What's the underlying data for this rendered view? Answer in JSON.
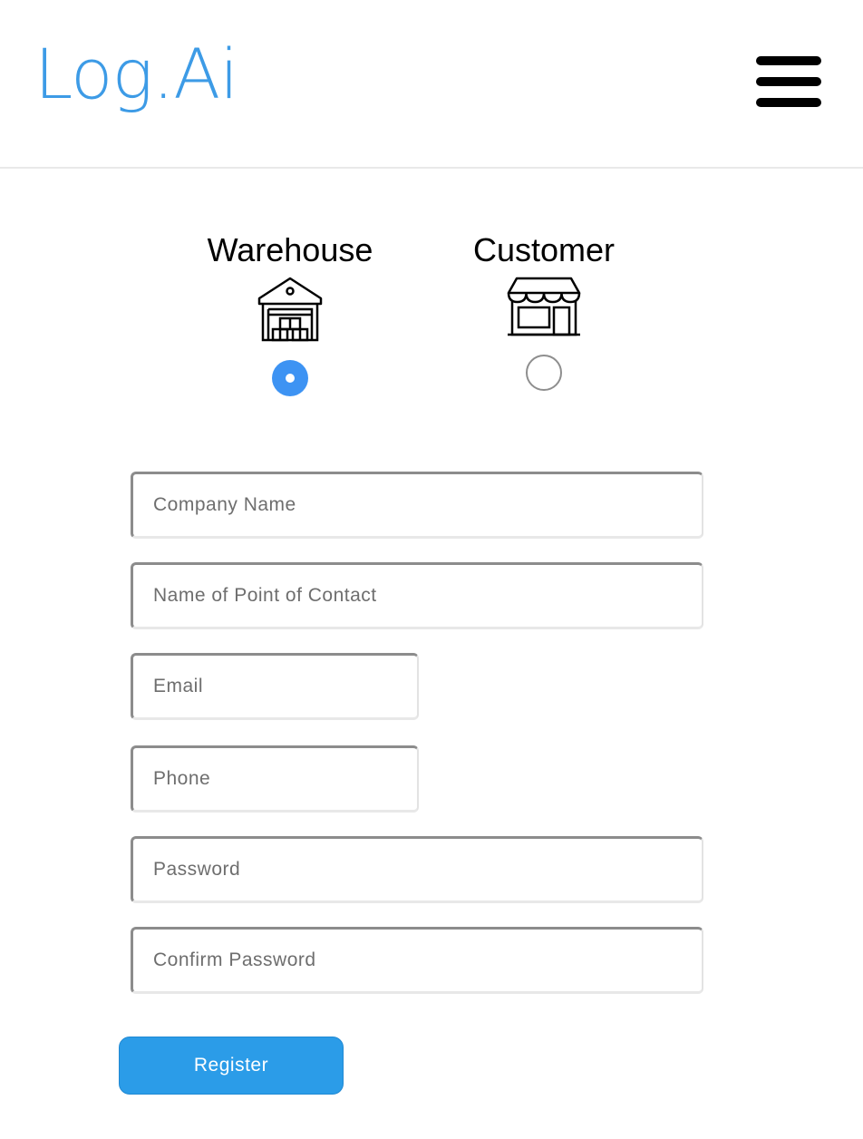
{
  "header": {
    "logo_text": "Log.Ai",
    "brand_color": "#3d9be6",
    "menu_icon": "hamburger-menu-icon"
  },
  "roles": [
    {
      "label": "Warehouse",
      "icon": "warehouse-icon",
      "selected": true
    },
    {
      "label": "Customer",
      "icon": "storefront-icon",
      "selected": false
    }
  ],
  "form": {
    "company_name": {
      "placeholder": "Company Name",
      "value": ""
    },
    "contact_name": {
      "placeholder": "Name of Point of Contact",
      "value": ""
    },
    "email": {
      "placeholder": "Email",
      "value": ""
    },
    "phone": {
      "placeholder": "Phone",
      "value": ""
    },
    "password": {
      "placeholder": "Password",
      "value": ""
    },
    "confirm_password": {
      "placeholder": "Confirm Password",
      "value": ""
    },
    "register_label": "Register",
    "button_color": "#2b9ce8",
    "radio_selected_color": "#3d93f3"
  }
}
